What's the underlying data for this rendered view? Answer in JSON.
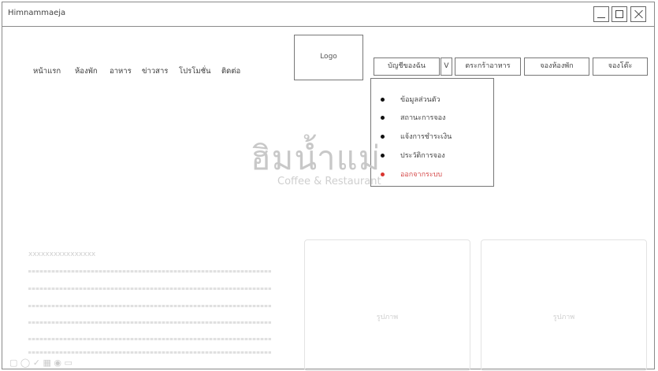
{
  "window": {
    "title": "Himnammaeja"
  },
  "nav": {
    "items": [
      "หน้าแรก",
      "ห้องพัก",
      "อาหาร",
      "ข่าวสาร",
      "โปรโมชั่น",
      "ติดต่อ"
    ]
  },
  "logo": {
    "label": "Logo"
  },
  "toolbar": {
    "account": "บัญชีของฉัน",
    "account_toggle": "V",
    "cart": "ตระกร้าอาหาร",
    "book_room": "จองห้องพัก",
    "book_table": "จองโต๊ะ"
  },
  "account_menu": {
    "items": [
      "ข้อมูลส่วนตัว",
      "สถานะการจอง",
      "แจ้งการชำระเงิน",
      "ประวัติการจอง"
    ],
    "logout": "ออกจากระบบ"
  },
  "hero": {
    "title": "ฮิมน้ำแม่",
    "subtitle": "Coffee & Restaurant"
  },
  "content": {
    "section_title": "xxxxxxxxxxxxxxxx",
    "image_label": "รูปภาพ"
  },
  "colors": {
    "logout": "#d9352f",
    "faded": "#d0d0d0"
  }
}
